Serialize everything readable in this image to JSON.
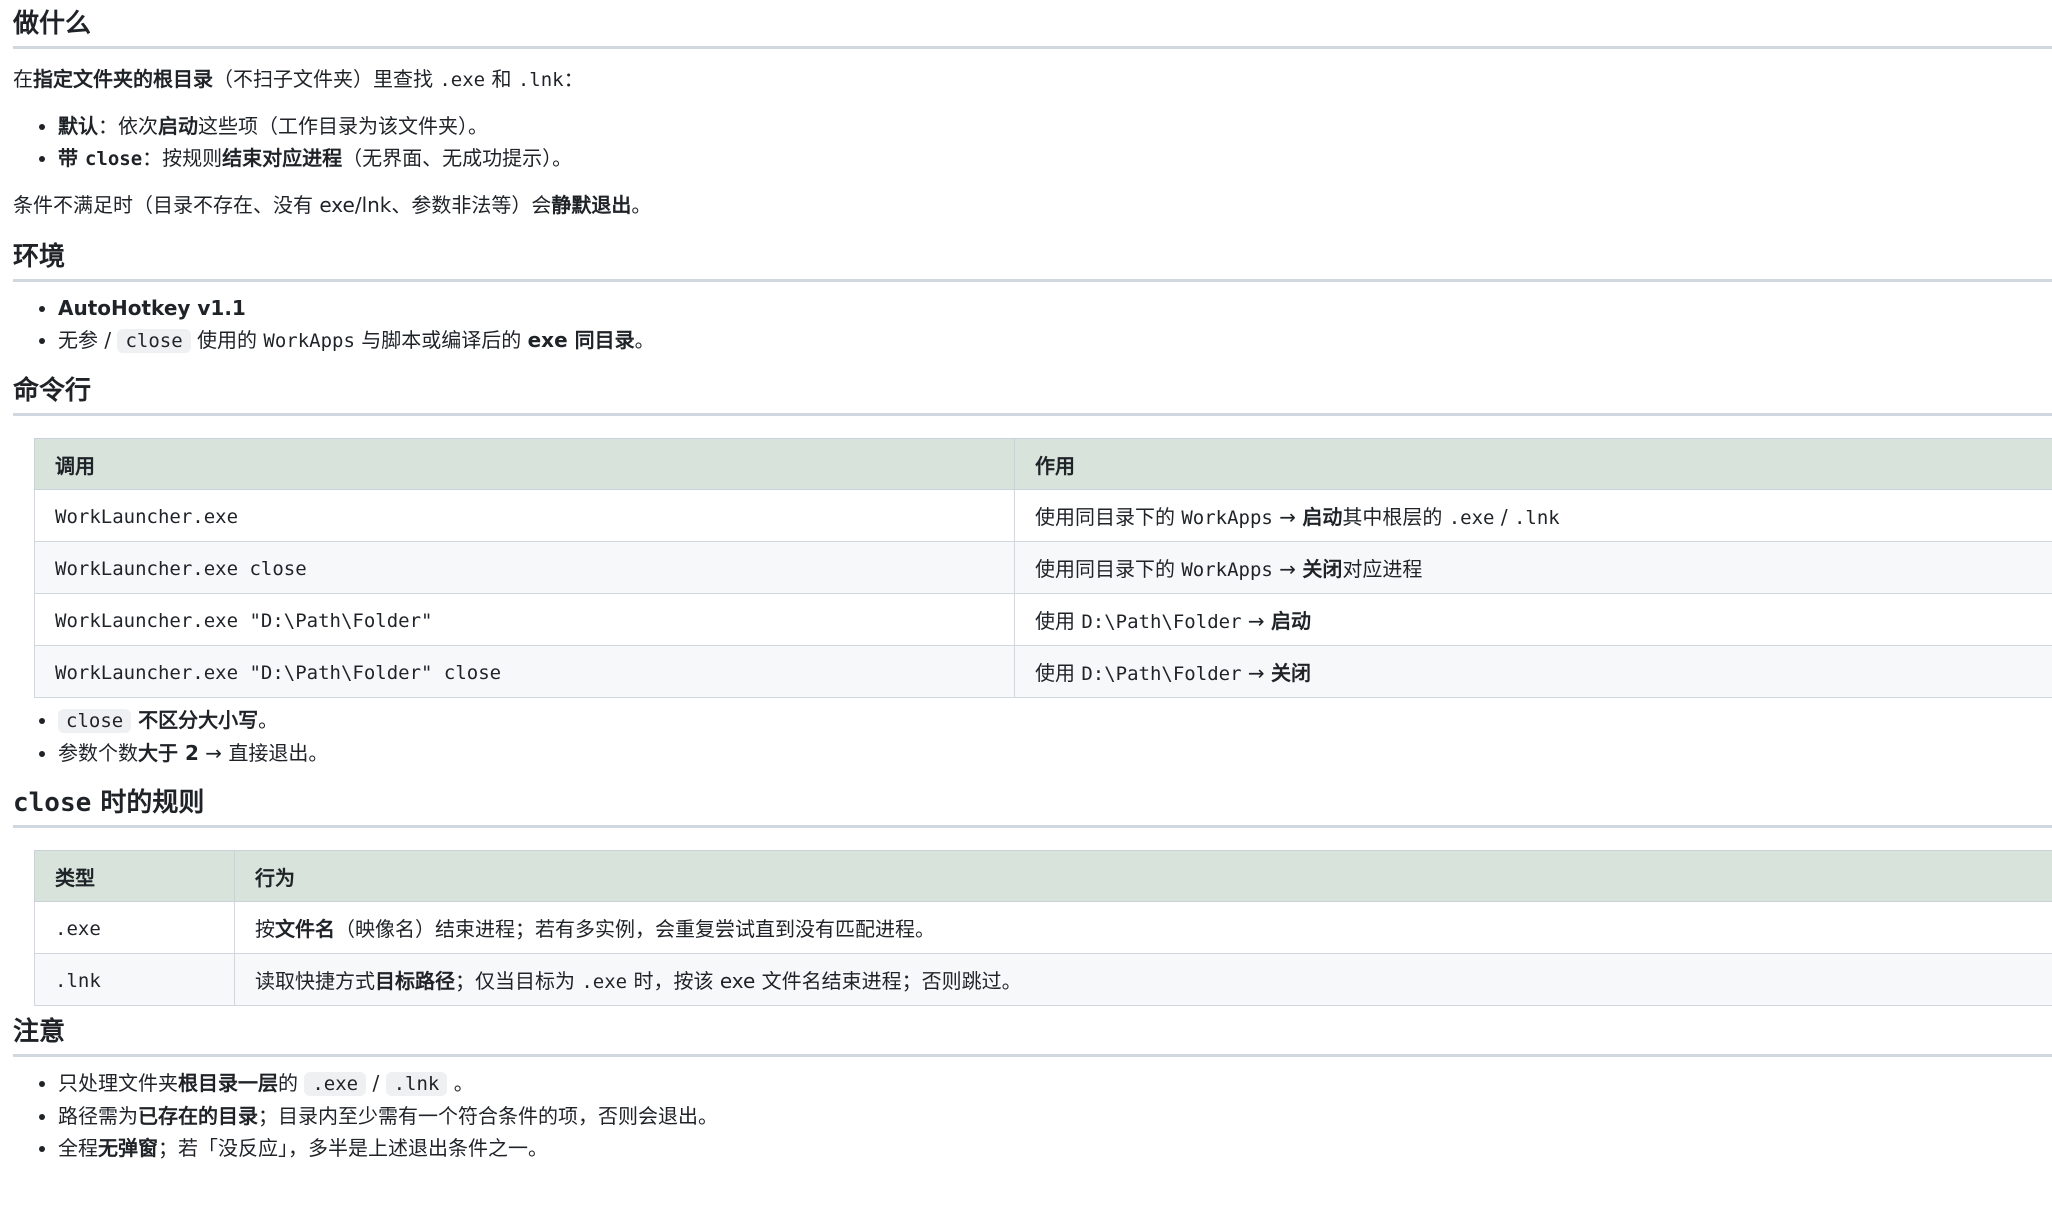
{
  "sec1": {
    "title": "做什么",
    "intro": {
      "p1": "在",
      "b1": "指定文件夹的根目录",
      "p2": "（不扫子文件夹）里查找 ",
      "c1": ".exe",
      "p3": " 和 ",
      "c2": ".lnk",
      "p4": "："
    },
    "items": [
      {
        "b1": "默认",
        "p1": "：依次",
        "b2": "启动",
        "p2": "这些项（工作目录为该文件夹）。"
      },
      {
        "b1": "带 ",
        "c1": "close",
        "p1": "：按规则",
        "b2": "结束对应进程",
        "p2": "（无界面、无成功提示）。"
      }
    ],
    "note": {
      "p1": "条件不满足时（目录不存在、没有 exe/lnk、参数非法等）会",
      "b1": "静默退出",
      "p2": "。"
    }
  },
  "sec2": {
    "title": "环境",
    "items": [
      {
        "b1": "AutoHotkey v1.1"
      },
      {
        "p1": "无参 / ",
        "c1": "close",
        "p2": " 使用的 ",
        "c2": "WorkApps",
        "p3": " 与脚本或编译后的 ",
        "b1": "exe 同目录",
        "p4": "。"
      }
    ]
  },
  "sec3": {
    "title": "命令行",
    "headers": [
      "调用",
      "作用"
    ],
    "rows": [
      {
        "cmd": "WorkLauncher.exe",
        "p1": "使用同目录下的 ",
        "c1": "WorkApps",
        "p2": " → ",
        "b1": "启动",
        "p3": "其中根层的 ",
        "c2": ".exe",
        "p4": " / ",
        "c3": ".lnk"
      },
      {
        "cmd": "WorkLauncher.exe close",
        "p1": "使用同目录下的 ",
        "c1": "WorkApps",
        "p2": " → ",
        "b1": "关闭",
        "p3": "对应进程"
      },
      {
        "cmd": "WorkLauncher.exe \"D:\\Path\\Folder\"",
        "p1": "使用 ",
        "c1": "D:\\Path\\Folder",
        "p2": " → ",
        "b1": "启动"
      },
      {
        "cmd": "WorkLauncher.exe \"D:\\Path\\Folder\" close",
        "p1": "使用 ",
        "c1": "D:\\Path\\Folder",
        "p2": " → ",
        "b1": "关闭"
      }
    ],
    "items": [
      {
        "c1": "close",
        "b1": " 不区分大小写",
        "p1": "。"
      },
      {
        "p1": "参数个数",
        "b1": "大于 2",
        "p2": " → 直接退出。"
      }
    ]
  },
  "sec4": {
    "title_code": "close",
    "title_rest": " 时的规则",
    "headers": [
      "类型",
      "行为"
    ],
    "rows": [
      {
        "type": ".exe",
        "p1": "按",
        "b1": "文件名",
        "p2": "（映像名）结束进程；若有多实例，会重复尝试直到没有匹配进程。"
      },
      {
        "type": ".lnk",
        "p1": "读取快捷方式",
        "b1": "目标路径",
        "p2": "；仅当目标为 ",
        "c1": ".exe",
        "p3": " 时，按该 exe 文件名结束进程；否则跳过。"
      }
    ]
  },
  "sec5": {
    "title": "注意",
    "items": [
      {
        "p1": "只处理文件夹",
        "b1": "根目录一层",
        "p2": "的 ",
        "c1": ".exe",
        "p3": " / ",
        "c2": ".lnk",
        "p4": " 。"
      },
      {
        "p1": "路径需为",
        "b1": "已存在的目录",
        "p2": "；目录内至少需有一个符合条件的项，否则会退出。"
      },
      {
        "p1": "全程",
        "b1": "无弹窗",
        "p2": "；若「没反应」，多半是上述退出条件之一。"
      }
    ]
  }
}
